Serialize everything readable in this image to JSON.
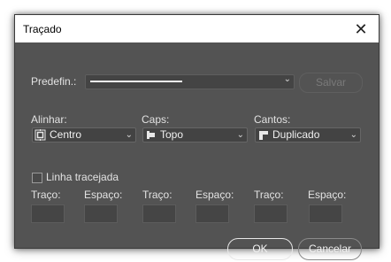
{
  "window": {
    "title": "Traçado",
    "close_glyph": "✕"
  },
  "preset": {
    "label": "Predefin.:",
    "save_label": "Salvar"
  },
  "align": {
    "label": "Alinhar:",
    "value": "Centro",
    "icon": "align-center-icon"
  },
  "caps": {
    "label": "Caps:",
    "value": "Topo",
    "icon": "cap-butt-icon"
  },
  "corners": {
    "label": "Cantos:",
    "value": "Duplicado",
    "icon": "corner-miter-icon"
  },
  "dashed": {
    "label": "Linha tracejada",
    "checked": false
  },
  "dash_fields": [
    {
      "label": "Traço:",
      "value": ""
    },
    {
      "label": "Espaço:",
      "value": ""
    },
    {
      "label": "Traço:",
      "value": ""
    },
    {
      "label": "Espaço:",
      "value": ""
    },
    {
      "label": "Traço:",
      "value": ""
    },
    {
      "label": "Espaço:",
      "value": ""
    }
  ],
  "buttons": {
    "ok": "OK",
    "cancel": "Cancelar"
  },
  "chevron_glyph": "⌄"
}
